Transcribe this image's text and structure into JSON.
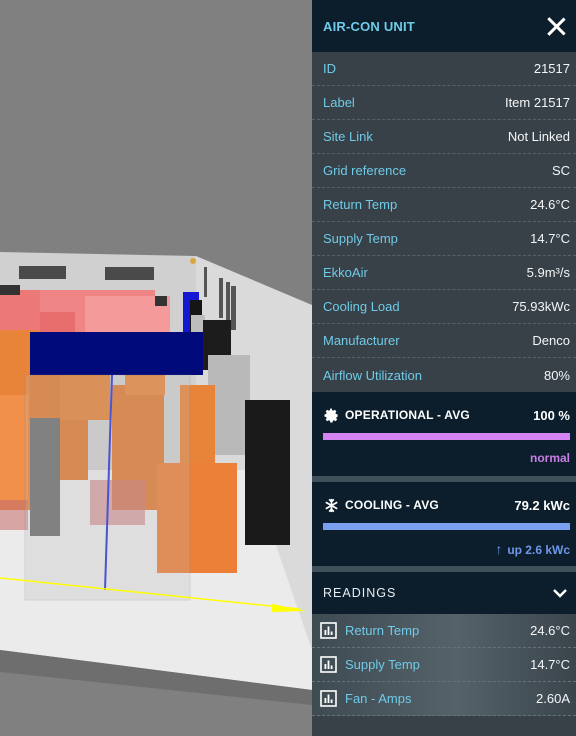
{
  "panel": {
    "title": "AIR-CON UNIT",
    "close_icon": "close-icon",
    "properties": [
      {
        "label": "ID",
        "value": "21517"
      },
      {
        "label": "Label",
        "value": "Item 21517"
      },
      {
        "label": "Site Link",
        "value": "Not Linked"
      },
      {
        "label": "Grid reference",
        "value": "SC"
      },
      {
        "label": "Return Temp",
        "value": "24.6°C"
      },
      {
        "label": "Supply Temp",
        "value": "14.7°C"
      },
      {
        "label": "EkkoAir",
        "value": "5.9m³/s"
      },
      {
        "label": "Cooling Load",
        "value": "75.93kWc"
      },
      {
        "label": "Manufacturer",
        "value": "Denco"
      },
      {
        "label": "Airflow Utilization",
        "value": "80%"
      }
    ],
    "metrics": [
      {
        "icon": "gear-icon",
        "title": "OPERATIONAL - AVG",
        "value": "100 %",
        "fill_percent": 100,
        "bar_color": "#d683f2",
        "note": "normal",
        "note_color": "#c97ee6"
      },
      {
        "icon": "snowflake-icon",
        "title": "COOLING - AVG",
        "value": "79.2 kWc",
        "fill_percent": 100,
        "bar_color": "#7aa0f0",
        "note_arrow": "↑",
        "note": "up 2.6 kWc",
        "note_color": "#6f97e8"
      }
    ],
    "readings": {
      "title": "READINGS",
      "toggle_icon": "chevron-down-icon",
      "items": [
        {
          "label": "Return Temp",
          "value": "24.6°C"
        },
        {
          "label": "Supply Temp",
          "value": "14.7°C"
        },
        {
          "label": "Fan - Amps",
          "value": "2.60A"
        }
      ]
    }
  },
  "scene": {
    "description": "3D data center floor view",
    "colors": {
      "background": "#808080",
      "wall": "#d9d9d9",
      "floor": "#ececec",
      "selected_unit": "#000a7a",
      "aircon_units": "#e8833a",
      "racks_pink": "#f08585",
      "racks_dark": "#1e1e1e",
      "racks_grey": "#c8c8c8",
      "airflow_arrow": "#ffff00"
    }
  },
  "accent": {
    "header_bg": "#0c1e2c",
    "label_color": "#6fcbe8",
    "panel_bg": "#384148"
  }
}
